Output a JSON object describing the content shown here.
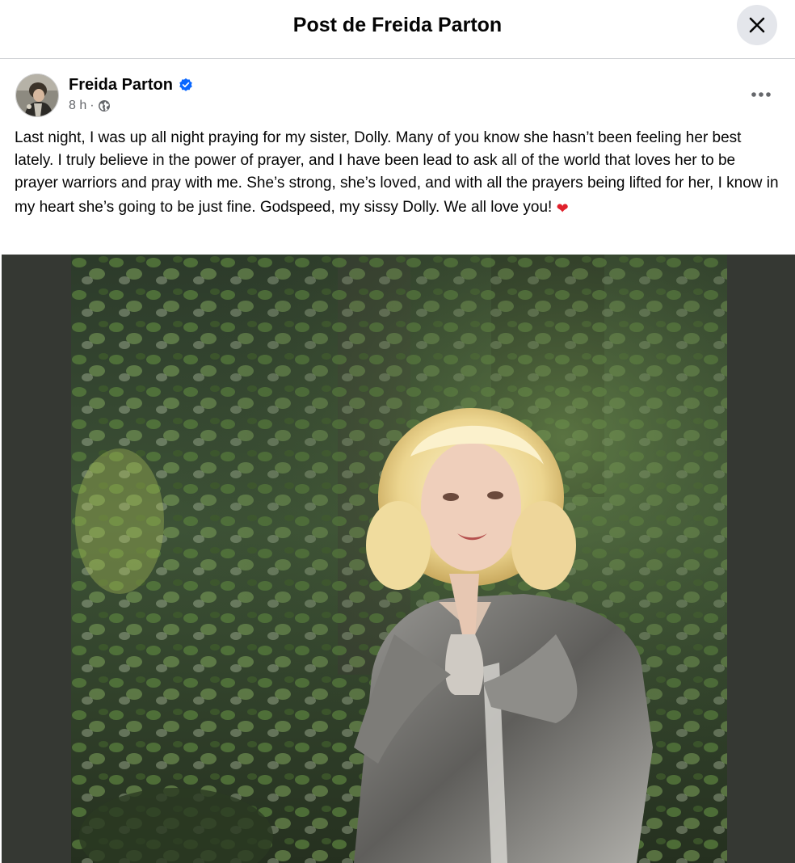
{
  "dialog": {
    "title": "Post de Freida Parton"
  },
  "icons": {
    "close": "close-icon",
    "verified": "verified-badge-icon",
    "globe": "globe-icon",
    "more": "more-options-icon",
    "heart": "red-heart-icon"
  },
  "colors": {
    "verified_blue": "#0866ff",
    "heart_red": "#e0202b",
    "photo_backdrop": "#353833",
    "secondary_text": "#65676b"
  },
  "post": {
    "author": "Freida Parton",
    "timestamp": "8 h",
    "separator": "·",
    "body": "Last night, I was up all night praying for my sister, Dolly. Many of you know she hasn’t been feeling her best lately. I truly believe in the power of prayer, and I have been lead to ask all of the world that loves her to be prayer warriors and pray with me. She’s strong, she’s loved, and with all the prayers being lifted for her, I know in my heart she’s going to be just fine. Godspeed, my sissy Dolly. We all love you!",
    "heart_emoji": "❤"
  }
}
